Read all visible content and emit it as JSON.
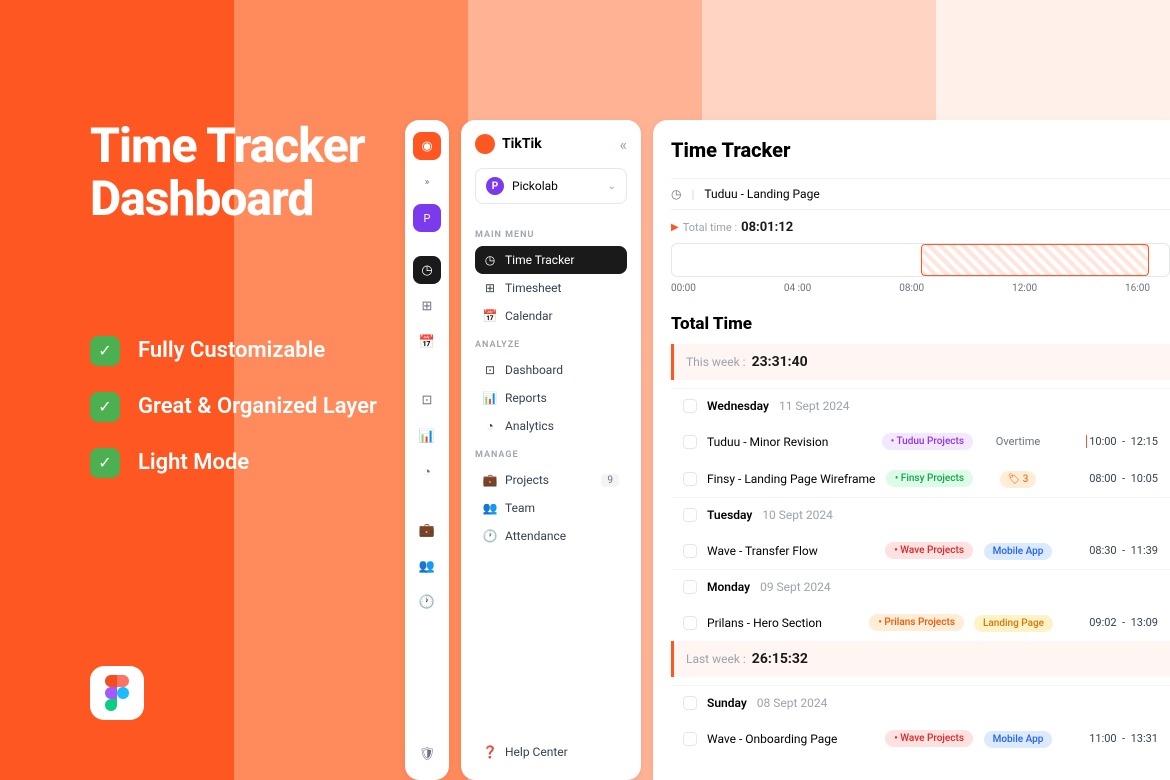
{
  "promo": {
    "title_l1": "Time Tracker",
    "title_l2": "Dashboard",
    "feat1": "Fully Customizable",
    "feat2": "Great & Organized Layer",
    "feat3": "Light Mode"
  },
  "brand": "TikTik",
  "workspace": {
    "name": "Pickolab",
    "initial": "P"
  },
  "sections": {
    "main": "MAIN MENU",
    "analyze": "ANALYZE",
    "manage": "MANAGE"
  },
  "nav": {
    "timetracker": "Time Tracker",
    "timesheet": "Timesheet",
    "calendar": "Calendar",
    "dashboard": "Dashboard",
    "reports": "Reports",
    "analytics": "Analytics",
    "projects": "Projects",
    "projects_badge": "9",
    "team": "Team",
    "attendance": "Attendance",
    "help": "Help Center"
  },
  "page": {
    "title": "Time Tracker",
    "current_task": "Tuduu - Landing Page",
    "total_label": "Total time :",
    "total_value": "08:01:12",
    "ticks": [
      "00:00",
      "04 :00",
      "08:00",
      "12:00",
      "16:00"
    ],
    "section": "Total Time"
  },
  "thisweek": {
    "label": "This week :",
    "value": "23:31:40"
  },
  "lastweek": {
    "label": "Last week :",
    "value": "26:15:32"
  },
  "days": {
    "wed": {
      "name": "Wednesday",
      "date": "11 Sept 2024"
    },
    "tue": {
      "name": "Tuesday",
      "date": "10 Sept 2024"
    },
    "mon": {
      "name": "Monday",
      "date": "09 Sept 2024"
    },
    "sun": {
      "name": "Sunday",
      "date": "08 Sept 2024"
    }
  },
  "entries": {
    "e1": {
      "name": "Tuduu - Minor Revision",
      "tag": "• Tuduu Projects",
      "extra": "Overtime",
      "t1": "10:00",
      "t2": "12:15"
    },
    "e2": {
      "name": "Finsy - Landing Page Wireframe",
      "tag": "• Finsy Projects",
      "extra": "3",
      "t1": "08:00",
      "t2": "10:05"
    },
    "e3": {
      "name": "Wave - Transfer Flow",
      "tag": "• Wave Projects",
      "extra": "Mobile App",
      "t1": "08:30",
      "t2": "11:39"
    },
    "e4": {
      "name": "Prilans - Hero Section",
      "tag": "• Prilans Projects",
      "extra": "Landing Page",
      "t1": "09:02",
      "t2": "13:09"
    },
    "e5": {
      "name": "Wave - Onboarding Page",
      "tag": "• Wave Projects",
      "extra": "Mobile App",
      "t1": "11:00",
      "t2": "13:31"
    }
  }
}
